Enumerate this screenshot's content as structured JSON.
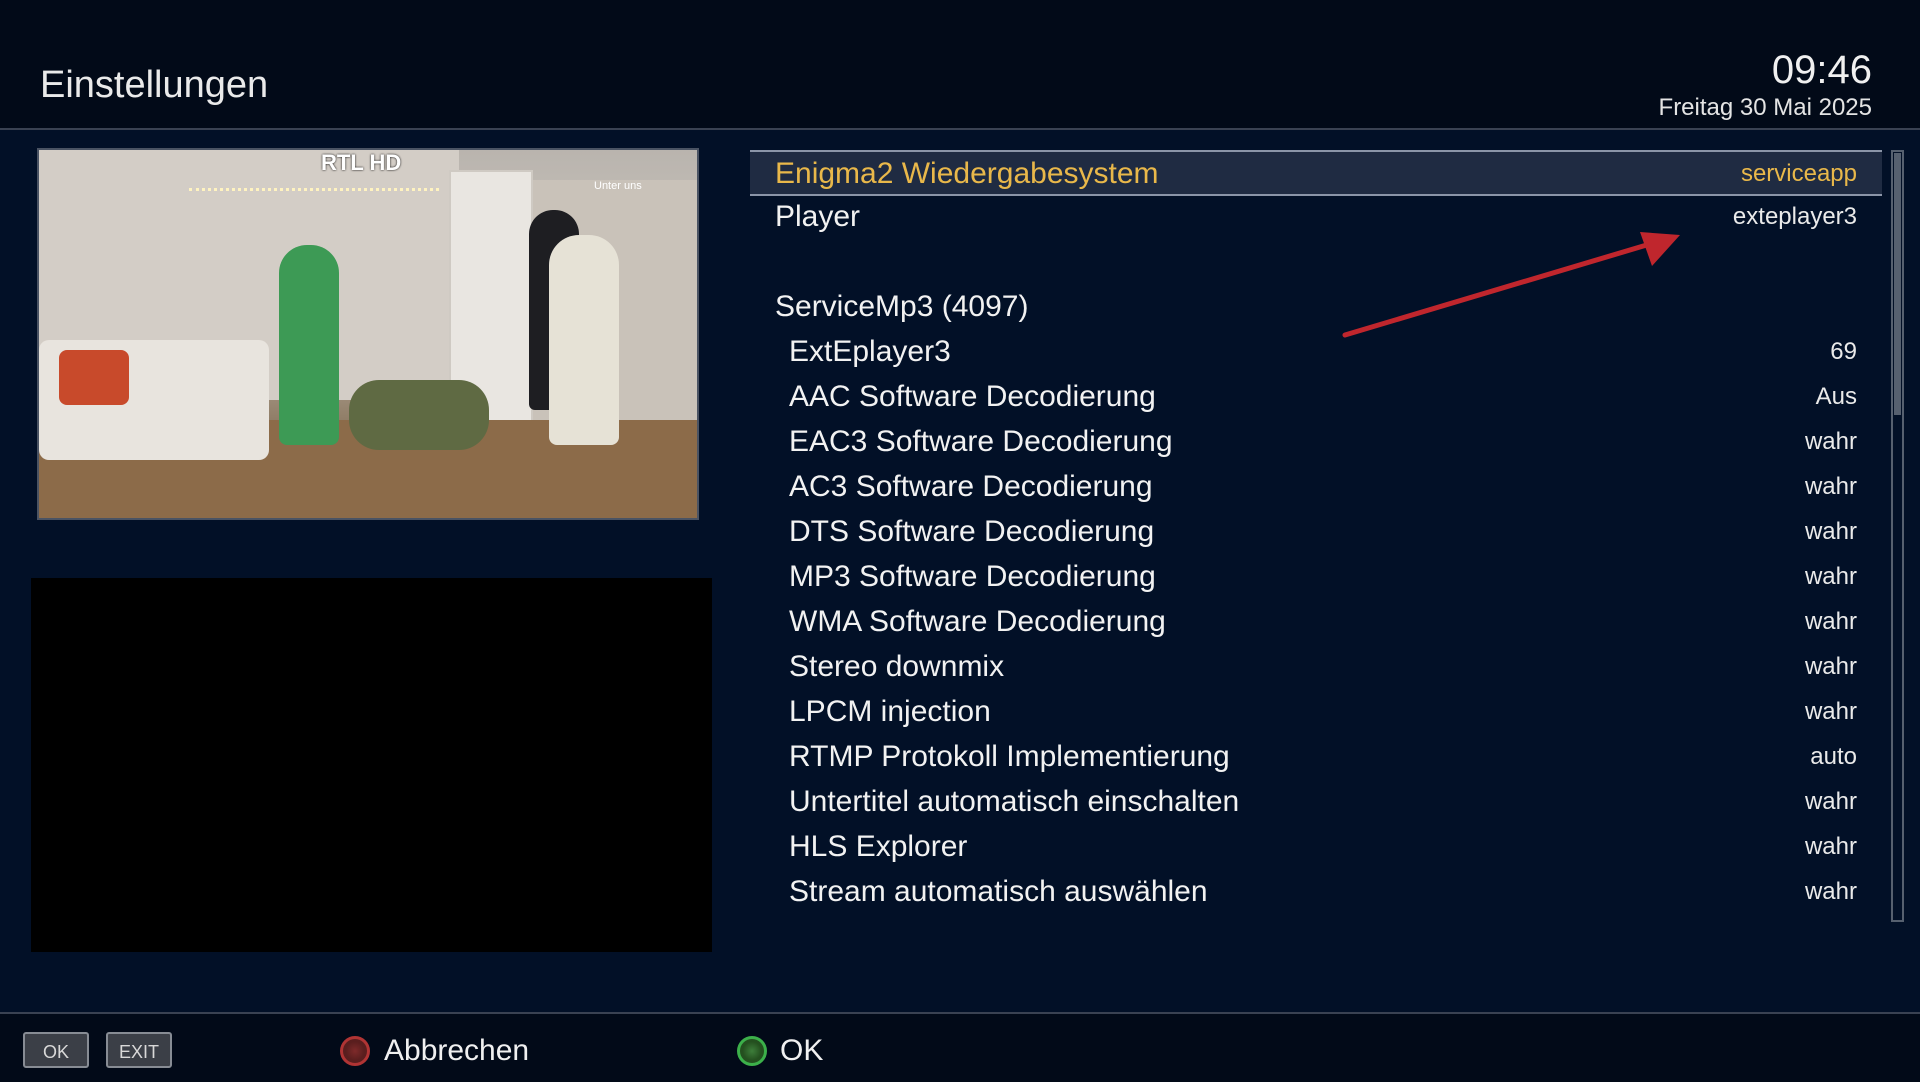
{
  "header": {
    "title": "Einstellungen",
    "time": "09:46",
    "date": "Freitag 30 Mai 2025"
  },
  "preview": {
    "channel_logo": "RTL HD",
    "program": "Unter uns"
  },
  "settings": [
    {
      "label": "Enigma2 Wiedergabesystem",
      "value": "serviceapp",
      "selected": true
    },
    {
      "label": "Player",
      "value": "exteplayer3"
    },
    {
      "label": "ServiceMp3 (4097)",
      "value": ""
    },
    {
      "label": "ExtEplayer3",
      "value": "69"
    },
    {
      "label": "AAC Software Decodierung",
      "value": "Aus"
    },
    {
      "label": "EAC3 Software Decodierung",
      "value": "wahr"
    },
    {
      "label": "AC3 Software Decodierung",
      "value": "wahr"
    },
    {
      "label": "DTS Software Decodierung",
      "value": "wahr"
    },
    {
      "label": "MP3 Software Decodierung",
      "value": "wahr"
    },
    {
      "label": "WMA Software Decodierung",
      "value": "wahr"
    },
    {
      "label": "Stereo downmix",
      "value": "wahr"
    },
    {
      "label": "LPCM injection",
      "value": "wahr"
    },
    {
      "label": "RTMP Protokoll Implementierung",
      "value": "auto"
    },
    {
      "label": "Untertitel automatisch einschalten",
      "value": "wahr"
    },
    {
      "label": "HLS Explorer",
      "value": "wahr"
    },
    {
      "label": "Stream automatisch auswählen",
      "value": "wahr"
    }
  ],
  "footer": {
    "ok_key": "OK",
    "exit_key": "EXIT",
    "red_label": "Abbrechen",
    "green_label": "OK"
  },
  "colors": {
    "background": "#021027",
    "selected_text": "#e9b84a",
    "annotation_arrow": "#c0262d",
    "red_button": "#b03434",
    "green_button": "#3cb04a"
  }
}
